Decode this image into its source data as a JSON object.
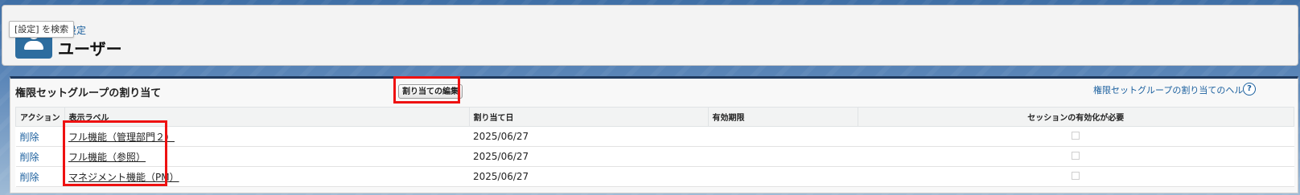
{
  "header": {
    "tooltip": "[設定] を検索",
    "breadcrumb": "設定",
    "title": "ユーザー",
    "icon": "user-icon"
  },
  "panel": {
    "title": "権限セットグループの割り当て",
    "edit_button": "割り当ての編集",
    "help_link": "権限セットグループの割り当てのヘルプ",
    "help_icon_glyph": "?"
  },
  "table": {
    "headers": [
      "アクション",
      "表示ラベル",
      "割り当て日",
      "有効期限",
      "セッションの有効化が必要"
    ],
    "rows": [
      {
        "action": "削除",
        "label": "フル機能（管理部門２）",
        "date": "2025/06/27",
        "expiry": ""
      },
      {
        "action": "削除",
        "label": "フル機能（参照）",
        "date": "2025/06/27",
        "expiry": ""
      },
      {
        "action": "削除",
        "label": "マネジメント機能（PM）",
        "date": "2025/06/27",
        "expiry": ""
      }
    ]
  },
  "colors": {
    "link": "#1a5f9e",
    "highlight": "#ee1111",
    "brand": "#2d6d9f"
  }
}
